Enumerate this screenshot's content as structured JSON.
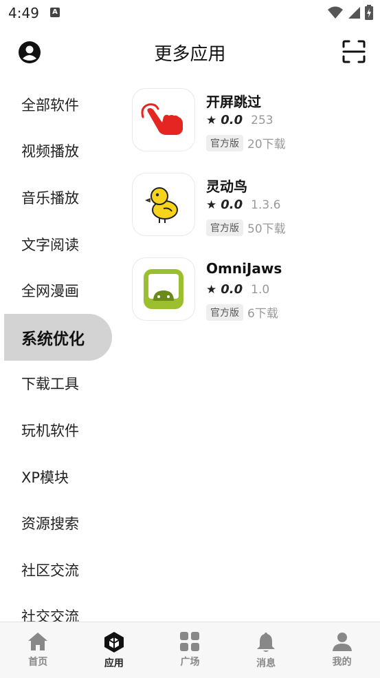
{
  "status_bar": {
    "time": "4:49",
    "notification_letter": "A"
  },
  "header": {
    "title": "更多应用"
  },
  "sidebar": {
    "items": [
      {
        "label": "全部软件"
      },
      {
        "label": "视频播放"
      },
      {
        "label": "音乐播放"
      },
      {
        "label": "文字阅读"
      },
      {
        "label": "全网漫画"
      },
      {
        "label": "系统优化",
        "active": true
      },
      {
        "label": "下载工具"
      },
      {
        "label": "玩机软件"
      },
      {
        "label": "XP模块"
      },
      {
        "label": "资源搜索"
      },
      {
        "label": "社区交流"
      },
      {
        "label": "社交交流"
      }
    ]
  },
  "apps": [
    {
      "name": "开屏跳过",
      "rating": "0.0",
      "version": "253",
      "badge": "官方版",
      "downloads": "20下载",
      "icon": "tap-hand-icon"
    },
    {
      "name": "灵动鸟",
      "rating": "0.0",
      "version": "1.3.6",
      "badge": "官方版",
      "downloads": "50下载",
      "icon": "chick-icon"
    },
    {
      "name": "OmniJaws",
      "rating": "0.0",
      "version": "1.0",
      "badge": "官方版",
      "downloads": "6下载",
      "icon": "android-icon"
    }
  ],
  "bottom_nav": {
    "items": [
      {
        "label": "首页",
        "icon": "home-icon"
      },
      {
        "label": "应用",
        "icon": "cube-icon",
        "active": true
      },
      {
        "label": "广场",
        "icon": "grid-icon"
      },
      {
        "label": "消息",
        "icon": "bell-icon"
      },
      {
        "label": "我的",
        "icon": "person-icon"
      }
    ]
  }
}
